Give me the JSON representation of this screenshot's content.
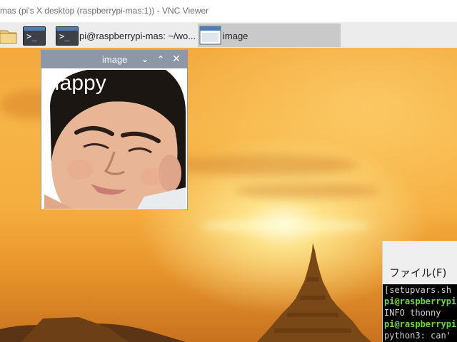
{
  "vnc": {
    "title": "mas (pi's X desktop (raspberrypi-mas:1)) - VNC Viewer"
  },
  "taskbar": {
    "terminal_task_label": "pi@raspberrypi-mas: ~/wo...",
    "image_task_label": "image"
  },
  "image_window": {
    "title": "image",
    "caption": "Happy",
    "buttons": [
      "chevron-down-icon",
      "chevron-up-icon",
      "close-icon"
    ]
  },
  "terminal": {
    "menu_file": "ファイル(F)",
    "lines": [
      {
        "text": "[setupvars.sh",
        "style": "grey"
      },
      {
        "text": "pi@raspberrypi",
        "style": "green"
      },
      {
        "text": "INFO    thonny",
        "style": "grey"
      },
      {
        "text": "pi@raspberrypi",
        "style": "green"
      },
      {
        "text": "python3: can'",
        "style": "grey"
      }
    ]
  },
  "colors": {
    "window_titlebar": "#8d97a6",
    "taskbar": "#ececec",
    "terminal_green": "#6cd93b"
  }
}
